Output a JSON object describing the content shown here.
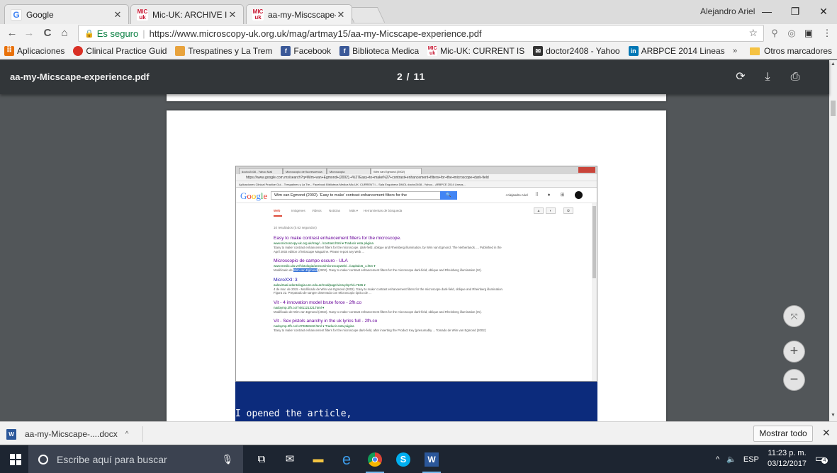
{
  "tabs": [
    {
      "title": "Google",
      "favicon": "google-g"
    },
    {
      "title": "Mic-UK: ARCHIVE ISSUE",
      "favicon": "micuk-logo"
    },
    {
      "title": "aa-my-Miscscape-experie",
      "favicon": "micuk-logo",
      "active": true
    }
  ],
  "favicon_text": {
    "mic_top": "MIC",
    "mic_bottom": "uk",
    "google": "G"
  },
  "window": {
    "user": "Alejandro Ariel",
    "minimize": "—",
    "maximize": "❐",
    "close": "✕"
  },
  "toolbar": {
    "back": "←",
    "forward": "→",
    "reload": "C",
    "home": "⌂",
    "secure_label": "Es seguro",
    "url": "https://www.microscopy-uk.org.uk/mag/artmay15/aa-my-Micscape-experience.pdf",
    "star": "☆",
    "menu": "⋮"
  },
  "bookmarks": [
    {
      "label": "Aplicaciones",
      "icon": "apps-grid-icon",
      "color": "#e8710a"
    },
    {
      "label": "Clinical Practice Guid",
      "icon": "clinical-icon",
      "color": "#d93025"
    },
    {
      "label": "Trespatines y La Trem",
      "icon": "trespatines-icon",
      "color": "#e8a33d"
    },
    {
      "label": "Facebook",
      "icon": "facebook-icon",
      "color": "#3b5998"
    },
    {
      "label": "Biblioteca Medica",
      "icon": "facebook-icon",
      "color": "#3b5998"
    },
    {
      "label": "Mic-UK: CURRENT IS",
      "icon": "micuk-icon",
      "color": "#c6132e"
    },
    {
      "label": "doctor2408 - Yahoo",
      "icon": "mail-icon",
      "color": "#333333"
    },
    {
      "label": "ARBPCE 2014 Lineas",
      "icon": "linkedin-icon",
      "color": "#0077b5"
    }
  ],
  "bookmarks_more": "»",
  "bookmarks_other": "Otros marcadores",
  "pdf": {
    "filename": "aa-my-Micscape-experience.pdf",
    "page_indicator": "2 / 11",
    "rotate": "⟳",
    "download": "⤓",
    "print": "⎙",
    "page_text": "I opened the article,",
    "zoom_fit": "⤧",
    "zoom_in": "+",
    "zoom_out": "−"
  },
  "embedded_screenshot": {
    "tabs": [
      "doctor2408 - Yahoo Mail",
      "Microscopio de fluorescencia",
      "Microscopia",
      "Wim van Egmond (2002)"
    ],
    "url": "https://www.google.com.mx/search?q=Wim+van+Egmond+(2002).+%27Easy+to+make%27+contrast+enhancement+filters+for+the+microscope+dark-field",
    "bookmarks": "Aplicaciones   Clinical Practice Gui...   Trespatines y La Tre...   Facebook   Biblioteca Medica   Mic-UK: CURRENT I...   Sala Enguinera DMOL   doctor2408 - Yahoo...   ARBPCE 2014 Lineas...",
    "search_query": "Wim van Egmond (2002). 'Easy to make' contrast enhancement filters for the",
    "search_button": "🔍",
    "user": "+Alejandro Ariel",
    "nav": [
      "Web",
      "Imágenes",
      "Videos",
      "Noticias",
      "Más ▾",
      "Herramientas de búsqueda"
    ],
    "result_count": "10 resultados (0.62 segundos)",
    "results": [
      {
        "title": "Easy to make contrast enhancement filters for the microscope.",
        "url": "www.microscopy-uk.org.uk/mag/.../contrast.html ▾ Traducir esta página",
        "snippet": "'Easy to make' contrast enhancement filters for the microscope. dark-field, oblique and Rheinberg illumination. by Wim van Egmond. The Netherlands. ... Published in the April 2002 edition of Micscape Magazine. Please report any Web ..."
      },
      {
        "title": "Microscopio de campo oscuro - ULA",
        "url": "www.medic.ula.ve/histologia/anexos/microscopweb/.../capitulo6_1.htm ▾",
        "snippet_before": "Modificado de ",
        "snippet_highlight": "Wim van Egmond",
        "snippet_after": " (2002). 'Easy to make' contrast enhancement filters for the microscope dark-field, oblique and Rheinberg illumination (IX)."
      },
      {
        "title": "MicroXXI: 3",
        "url": "aulavirtual.odontologia.unc.edu.ar/mod/page/view.php?id=7636 ▾",
        "snippet": "4 de mar. de 2015 - Modificado de Wim van Egmond (2002). 'Easy to make' contrast enhancement filters for the microscope dark-field, oblique and Rheinberg illumination. Figura 22. Preparado de sangre observado con Microscopio óptico de ..."
      },
      {
        "title": "Vit - 4 innovation model brute force - 2fh.co",
        "url": "nadoymp.2fh.co/7481121321.html ▾",
        "snippet": "Modificado de Wim van Egmond (2002). 'Easy to make' contrast enhancement filters for the microscope dark-field, oblique and Rheinberg illumination (IX)."
      },
      {
        "title": "Vit - Sex pistols anarchy in the uk lyrics full - 2fh.co",
        "url": "nadoymp.2fh.co/1472658162.html ▾ Traducir esta página",
        "snippet": "'Easy to make' contrast enhancement filters for the microscope dark-field, after inserting the Product Key (presumably ... Tomado de Wim van Egmond (2002):"
      }
    ]
  },
  "downloads": {
    "file": "aa-my-Micscape-....docx",
    "show_all": "Mostrar todo",
    "close": "✕",
    "caret": "^"
  },
  "taskbar": {
    "search_placeholder": "Escribe aquí para buscar",
    "language": "ESP",
    "time": "11:23 p. m.",
    "date": "03/12/2017",
    "notifications": "4"
  }
}
